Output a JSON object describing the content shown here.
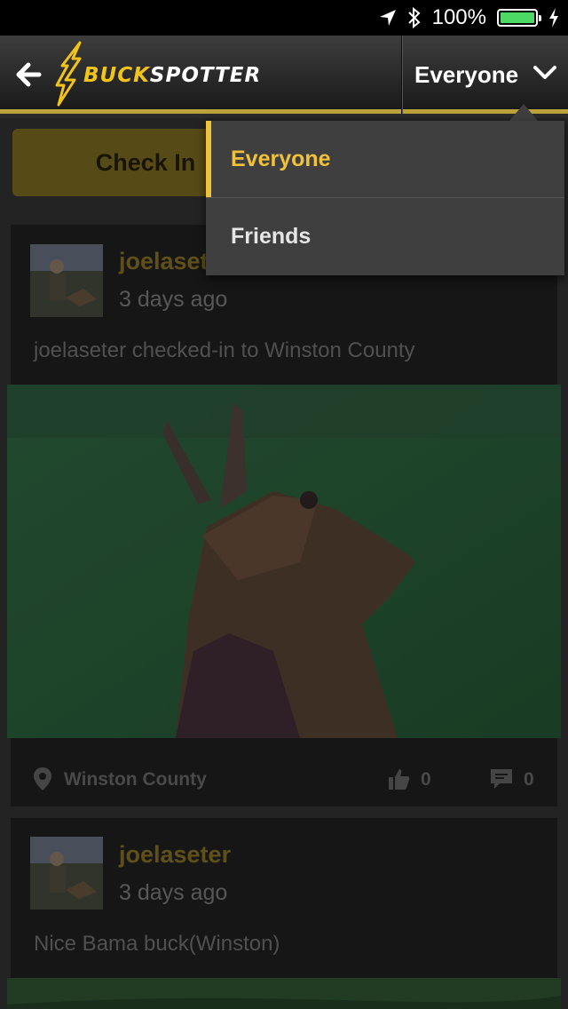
{
  "status_bar": {
    "battery_text": "100%",
    "battery_level": 1.0
  },
  "header": {
    "logo_part1": "BUCK",
    "logo_part2": "SPOTTER",
    "filter_label": "Everyone"
  },
  "checkin": {
    "label": "Check In"
  },
  "dropdown": {
    "items": [
      {
        "label": "Everyone",
        "selected": true
      },
      {
        "label": "Friends",
        "selected": false
      }
    ]
  },
  "feed": [
    {
      "username": "joelaseter",
      "username_visible": "joelaset",
      "time": "3 days ago",
      "text": "joelaseter checked-in to Winston County",
      "location": "Winston County",
      "likes": "0",
      "comments": "0"
    },
    {
      "username": "joelaseter",
      "time": "3 days ago",
      "text": "Nice Bama buck(Winston)"
    }
  ],
  "colors": {
    "accent": "#f0c13a",
    "header_border": "#bba23a",
    "battery": "#4cd964"
  }
}
